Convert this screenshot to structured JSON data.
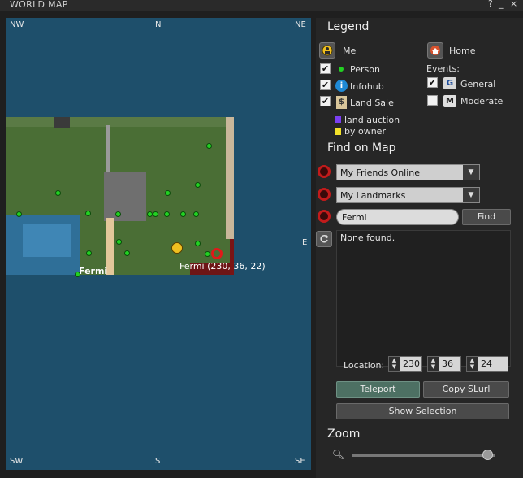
{
  "window": {
    "title": "WORLD MAP",
    "help": "?",
    "minimize": "_",
    "close": "×"
  },
  "map": {
    "compass": {
      "nw": "NW",
      "n": "N",
      "ne": "NE",
      "w": "W",
      "e": "E",
      "sw": "SW",
      "s": "S",
      "se": "SE"
    },
    "region_name": "Fermi",
    "target_label": "Fermi (230, 36, 22)"
  },
  "legend": {
    "title": "Legend",
    "me": "Me",
    "home": "Home",
    "events_label": "Events:",
    "person": "Person",
    "infohub": "Infohub",
    "land_sale": "Land Sale",
    "general": "General",
    "moderate": "Moderate",
    "general_badge": "G",
    "moderate_badge": "M",
    "land_auction": "land auction",
    "by_owner": "by owner",
    "checks": {
      "person": true,
      "infohub": true,
      "land_sale": true,
      "general": true,
      "moderate": false
    },
    "colors": {
      "land_auction": "#7b3ff2",
      "by_owner": "#f2e12a"
    }
  },
  "find": {
    "title": "Find on Map",
    "friends_combo": "My Friends Online",
    "landmarks_combo": "My Landmarks",
    "search_value": "Fermi",
    "find_button": "Find",
    "results_text": "None found."
  },
  "location": {
    "label": "Location:",
    "x": "230",
    "y": "36",
    "z": "24"
  },
  "buttons": {
    "teleport": "Teleport",
    "copy_slurl": "Copy SLurl",
    "show_selection": "Show Selection"
  },
  "zoom": {
    "title": "Zoom",
    "level": 0.95
  }
}
